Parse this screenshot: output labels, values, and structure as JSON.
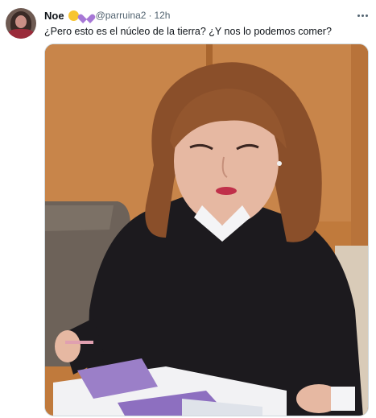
{
  "tweet": {
    "author_name": "Noe",
    "author_badges": [
      "yellow-heart-emoji",
      "purple-heart-emoji"
    ],
    "handle": "@parruina2",
    "separator": "·",
    "timestamp": "12h",
    "text": "¿Pero esto es el núcleo de la tierra? ¿Y nos lo podemos comer?",
    "media": {
      "description_icon": "photo",
      "colors": {
        "wall": "#c07a3c",
        "sweater": "#1c1a1e",
        "hair": "#8a4f2a",
        "skin": "#e6b8a2",
        "folder": "#9b7fc8"
      }
    }
  }
}
